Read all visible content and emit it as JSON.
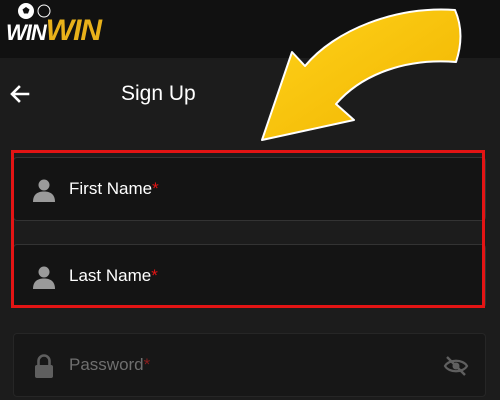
{
  "brand": {
    "logo_part1": "WIN",
    "logo_part2": "WIN"
  },
  "colors": {
    "accent_red": "#e31414",
    "arrow_yellow": "#f5c400",
    "logo_gold": "#e8b11a"
  },
  "header": {
    "title": "Sign Up",
    "back_icon": "arrow-left-icon"
  },
  "form": {
    "first_name": {
      "placeholder": "First Name",
      "required_mark": "*",
      "icon": "user-icon"
    },
    "last_name": {
      "placeholder": "Last Name",
      "required_mark": "*",
      "icon": "user-icon"
    },
    "password": {
      "placeholder": "Password",
      "required_mark": "*",
      "icon": "lock-icon",
      "toggle_icon": "eye-off-icon"
    }
  }
}
